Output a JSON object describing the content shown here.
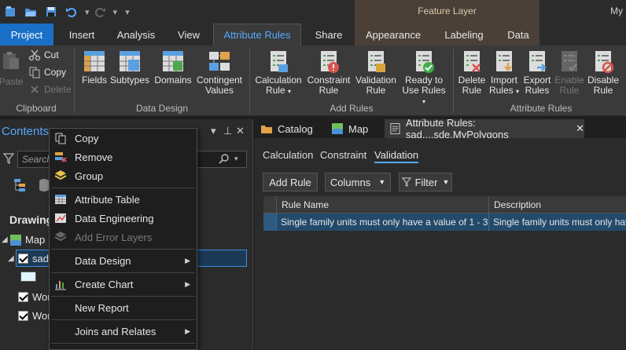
{
  "title_bar": {
    "context_title": "Feature Layer",
    "app_title_fragment": "My"
  },
  "tabs": {
    "project": "Project",
    "insert": "Insert",
    "analysis": "Analysis",
    "view": "View",
    "attribute_rules": "Attribute Rules",
    "share": "Share",
    "appearance": "Appearance",
    "labeling": "Labeling",
    "data": "Data"
  },
  "ribbon": {
    "clipboard": {
      "paste": "Paste",
      "cut": "Cut",
      "copy": "Copy",
      "delete": "Delete",
      "group": "Clipboard"
    },
    "data_design": {
      "fields": "Fields",
      "subtypes": "Subtypes",
      "domains": "Domains",
      "contingent_1": "Contingent",
      "contingent_2": "Values",
      "group": "Data Design"
    },
    "add_rules": {
      "calculation_1": "Calculation",
      "calculation_2": "Rule",
      "constraint_1": "Constraint",
      "constraint_2": "Rule",
      "validation_1": "Validation",
      "validation_2": "Rule",
      "ready_1": "Ready to",
      "ready_2": "Use Rules",
      "group": "Add Rules"
    },
    "attribute_rules": {
      "delete_1": "Delete",
      "delete_2": "Rule",
      "import_1": "Import",
      "import_2": "Rules",
      "export_1": "Export",
      "export_2": "Rules",
      "enable_1": "Enable",
      "enable_2": "Rule",
      "disable_1": "Disable",
      "disable_2": "Rule",
      "group": "Attribute Rules"
    }
  },
  "contents": {
    "title": "Contents",
    "search_placeholder": "Search",
    "drawing_order": "Drawing",
    "map": "Map",
    "layer_selected": "sade",
    "layer_2": "Wor",
    "layer_3": "Wor"
  },
  "doc_tabs": {
    "catalog": "Catalog",
    "map": "Map",
    "attribute_rules": "Attribute Rules: sad....sde.MyPolygons"
  },
  "rules_view": {
    "sub_tabs": {
      "calculation": "Calculation",
      "constraint": "Constraint",
      "validation": "Validation"
    },
    "buttons": {
      "add_rule": "Add Rule",
      "columns": "Columns",
      "filter": "Filter"
    },
    "columns": [
      "Rule Name",
      "Description"
    ],
    "rows": [
      {
        "rule_name": "Single family units must only have a value of 1 - 3",
        "description": "Single family units must only hav"
      }
    ]
  },
  "context_menu": {
    "copy": "Copy",
    "remove": "Remove",
    "group": "Group",
    "attribute_table": "Attribute Table",
    "data_engineering": "Data Engineering",
    "add_error_layers": "Add Error Layers",
    "data_design": "Data Design",
    "create_chart": "Create Chart",
    "new_report": "New Report",
    "joins_and_relates": "Joins and Relates"
  },
  "colors": {
    "accent": "#55a9ff",
    "project_tab": "#1a6fc7",
    "context_tab": "#4a4037",
    "selected_row": "#234a6b"
  }
}
